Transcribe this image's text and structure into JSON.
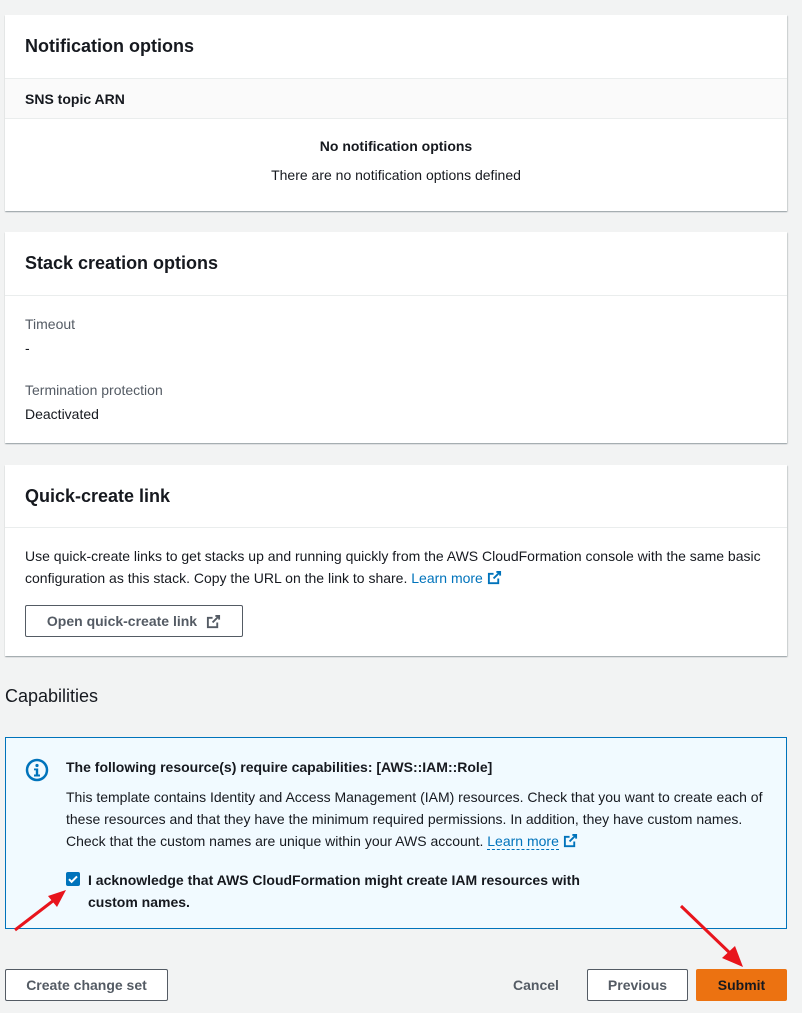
{
  "notification_panel": {
    "title": "Notification options",
    "column_header": "SNS topic ARN",
    "empty_title": "No notification options",
    "empty_desc": "There are no notification options defined"
  },
  "stack_creation_panel": {
    "title": "Stack creation options",
    "timeout_label": "Timeout",
    "timeout_value": "-",
    "termination_label": "Termination protection",
    "termination_value": "Deactivated"
  },
  "quick_create_panel": {
    "title": "Quick-create link",
    "description": "Use quick-create links to get stacks up and running quickly from the AWS CloudFormation console with the same basic configuration as this stack. Copy the URL on the link to share.",
    "learn_more": "Learn more",
    "open_button": "Open quick-create link"
  },
  "capabilities": {
    "section_title": "Capabilities",
    "alert_title": "The following resource(s) require capabilities: [AWS::IAM::Role]",
    "alert_text": "This template contains Identity and Access Management (IAM) resources. Check that you want to create each of these resources and that they have the minimum required permissions. In addition, they have custom names. Check that the custom names are unique within your AWS account.",
    "learn_more": "Learn more",
    "acknowledge_label": "I acknowledge that AWS CloudFormation might create IAM resources with custom names.",
    "acknowledge_checked": true
  },
  "actions": {
    "create_change_set": "Create change set",
    "cancel": "Cancel",
    "previous": "Previous",
    "submit": "Submit"
  },
  "colors": {
    "primary_button": "#ec7211",
    "link": "#0073bb",
    "info_border": "#0073bb",
    "annotation_arrow": "#e8141c"
  }
}
